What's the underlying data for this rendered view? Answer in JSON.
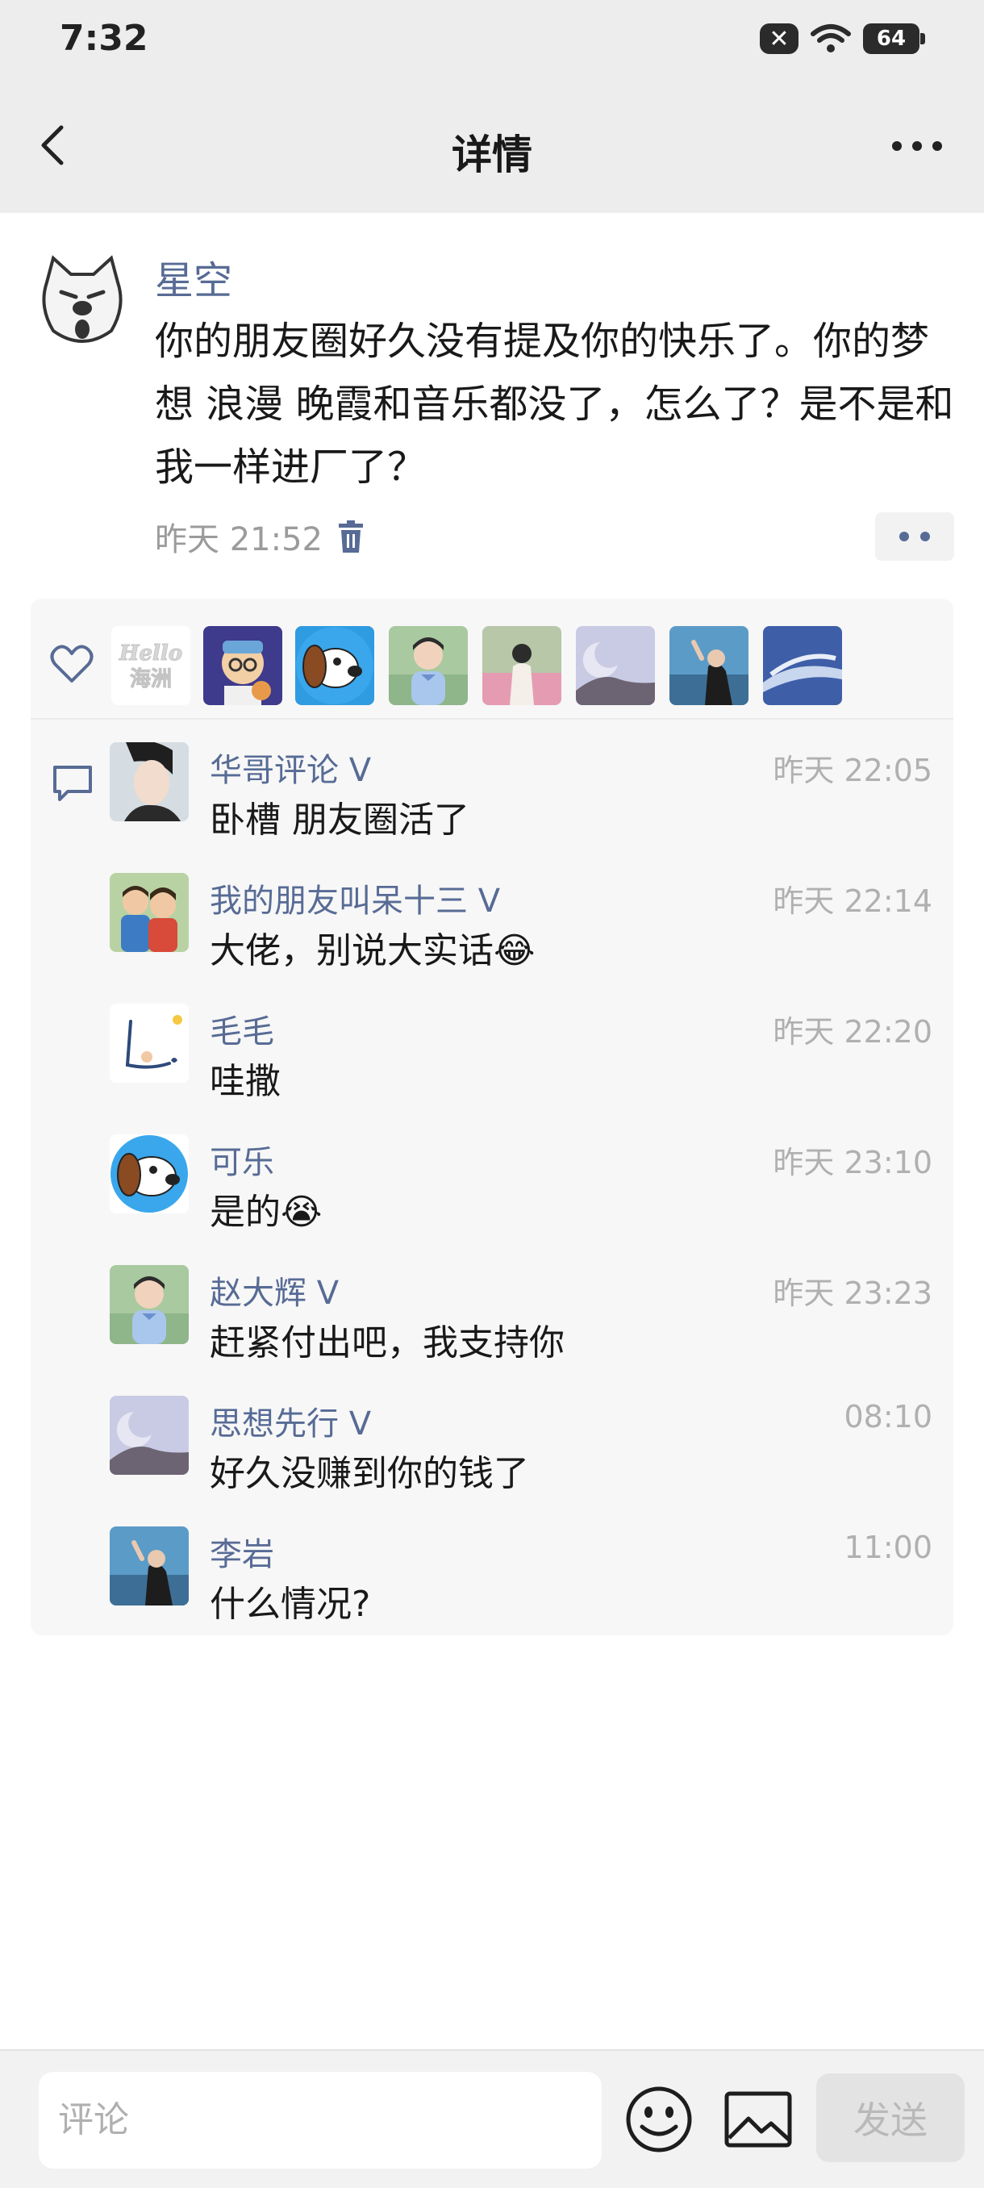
{
  "status_bar": {
    "time": "7:32",
    "close_badge": "✕",
    "battery": "64"
  },
  "nav": {
    "title": "详情",
    "back_icon": "chevron-left-icon",
    "more_icon": "more-dots-icon"
  },
  "post": {
    "author": "星空",
    "text": "你的朋友圈好久没有提及你的快乐了。你的梦想 浪漫 晚霞和音乐都没了，怎么了？是不是和我一样进厂了？",
    "time": "昨天 21:52"
  },
  "likes": {
    "first_avatar_text": "Hello\n海洲",
    "count_shown": 8
  },
  "comments": [
    {
      "name": "华哥评论 V",
      "time": "昨天 22:05",
      "text": "卧槽 朋友圈活了"
    },
    {
      "name": "我的朋友叫呆十三 V",
      "time": "昨天 22:14",
      "text": "大佬，别说大实话😂"
    },
    {
      "name": "毛毛",
      "time": "昨天 22:20",
      "text": "哇撒"
    },
    {
      "name": "可乐",
      "time": "昨天 23:10",
      "text": "是的😭"
    },
    {
      "name": "赵大辉 V",
      "time": "昨天 23:23",
      "text": "赶紧付出吧，我支持你"
    },
    {
      "name": "思想先行 V",
      "time": "08:10",
      "text": "好久没赚到你的钱了"
    },
    {
      "name": "李岩",
      "time": "11:00",
      "text": "什么情况?"
    }
  ],
  "bottom_bar": {
    "placeholder": "评论",
    "send_label": "发送"
  },
  "colors": {
    "link_blue": "#576b95",
    "bar_gray": "#ededed",
    "panel_gray": "#f7f7f7"
  }
}
